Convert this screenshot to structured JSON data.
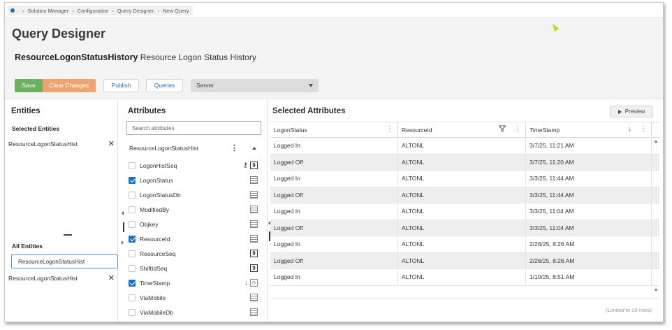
{
  "breadcrumb": [
    "Solution Manager",
    "Configuration",
    "Query Designer",
    "New Query"
  ],
  "page_title": "Query Designer",
  "entity": {
    "name": "ResourceLogonStatusHistory",
    "display_name": "Resource Logon Status History"
  },
  "toolbar": {
    "save": "Save",
    "clear": "Clear Changes",
    "publish": "Publish",
    "queries": "Queries",
    "server_value": "Server"
  },
  "entities_panel": {
    "title": "Entities",
    "selected_heading": "Selected Entities",
    "selected": [
      "ResourceLogonStatusHist"
    ],
    "all_heading": "All Entities",
    "search_value": "ResourceLogonStatusHist",
    "all": [
      "ResourceLogonStatusHist"
    ]
  },
  "attributes_panel": {
    "title": "Attributes",
    "search_placeholder": "Search attributes",
    "group": "ResourceLogonStatusHist",
    "items": [
      {
        "name": "LogonHistSeq",
        "checked": false,
        "type": "number",
        "extra": "key-icon"
      },
      {
        "name": "LogonStatus",
        "checked": true,
        "type": "text"
      },
      {
        "name": "LogonStatusDb",
        "checked": false,
        "type": "text"
      },
      {
        "name": "ModifiedBy",
        "checked": false,
        "type": "text"
      },
      {
        "name": "Objkey",
        "checked": false,
        "type": "text"
      },
      {
        "name": "ResourceId",
        "checked": true,
        "type": "text"
      },
      {
        "name": "ResourceSeq",
        "checked": false,
        "type": "number"
      },
      {
        "name": "ShiftIdSeq",
        "checked": false,
        "type": "number"
      },
      {
        "name": "TimeStamp",
        "checked": true,
        "type": "datetime",
        "extra": "sort-down-icon"
      },
      {
        "name": "ViaMobile",
        "checked": false,
        "type": "text"
      },
      {
        "name": "ViaMobileDb",
        "checked": false,
        "type": "text"
      }
    ]
  },
  "selected_panel": {
    "title": "Selected Attributes",
    "preview": "Preview",
    "columns": [
      "LogonStatus",
      "ResourceId",
      "TimeStamp"
    ],
    "rows": [
      [
        "Logged In",
        "ALTONL",
        "3/7/25, 11:21 AM"
      ],
      [
        "Logged Off",
        "ALTONL",
        "3/7/25, 11:20 AM"
      ],
      [
        "Logged In",
        "ALTONL",
        "3/3/25, 11:44 AM"
      ],
      [
        "Logged Off",
        "ALTONL",
        "3/3/25, 11:44 AM"
      ],
      [
        "Logged In",
        "ALTONL",
        "3/3/25, 11:04 AM"
      ],
      [
        "Logged Off",
        "ALTONL",
        "3/3/25, 11:04 AM"
      ],
      [
        "Logged In",
        "ALTONL",
        "2/26/25, 8:26 AM"
      ],
      [
        "Logged Off",
        "ALTONL",
        "2/26/25, 8:26 AM"
      ],
      [
        "Logged In",
        "ALTONL",
        "1/10/25, 8:51 AM"
      ]
    ],
    "limit_note": "(Limited to 10 rows)"
  },
  "colors": {
    "save": "#6bb15f",
    "clear": "#eea472",
    "accent": "#1e73b9"
  }
}
